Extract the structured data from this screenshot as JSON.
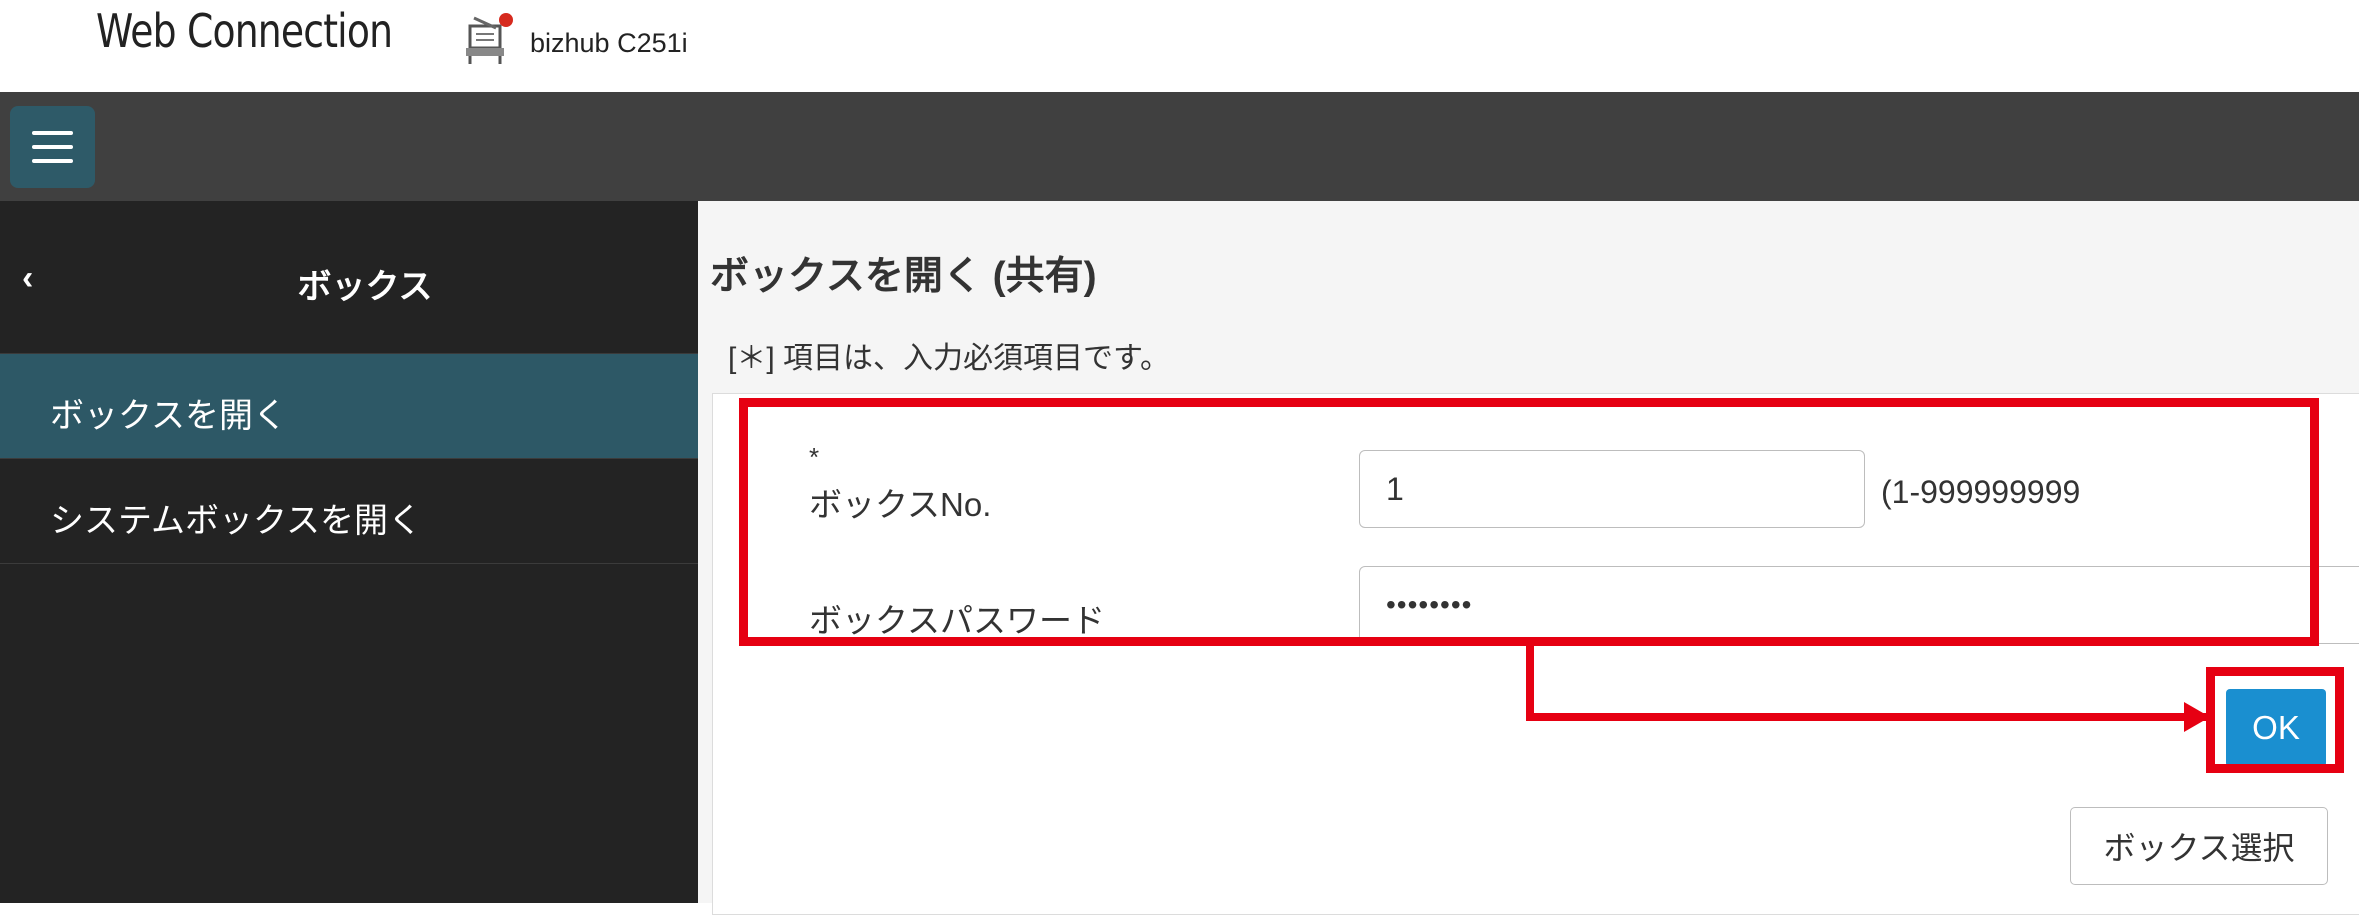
{
  "header": {
    "app_title": "Web Connection",
    "device_name": "bizhub C251i",
    "icon": "printer-icon"
  },
  "toolbar": {
    "menu_icon": "hamburger-menu-icon"
  },
  "sidebar": {
    "back_icon": "chevron-left-icon",
    "back_glyph": "‹",
    "title": "ボックス",
    "items": [
      {
        "label": "ボックスを開く",
        "active": true
      },
      {
        "label": "システムボックスを開く",
        "active": false
      }
    ]
  },
  "main": {
    "title": "ボックスを開く (共有)",
    "required_note": "[＊] 項目は、入力必須項目です。",
    "required_mark": "*",
    "box_no_label": "ボックスNo.",
    "box_no_value": "1",
    "box_no_range": "(1-999999999",
    "password_label": "ボックスパスワード",
    "password_value": "••••••••",
    "ok_label": "OK",
    "box_select_label": "ボックス選択"
  },
  "colors": {
    "accent": "#2d5866",
    "ok_button": "#1a8fd0",
    "annotation": "#e60012",
    "toolbar_bg": "#404040",
    "sidebar_bg": "#232323"
  }
}
